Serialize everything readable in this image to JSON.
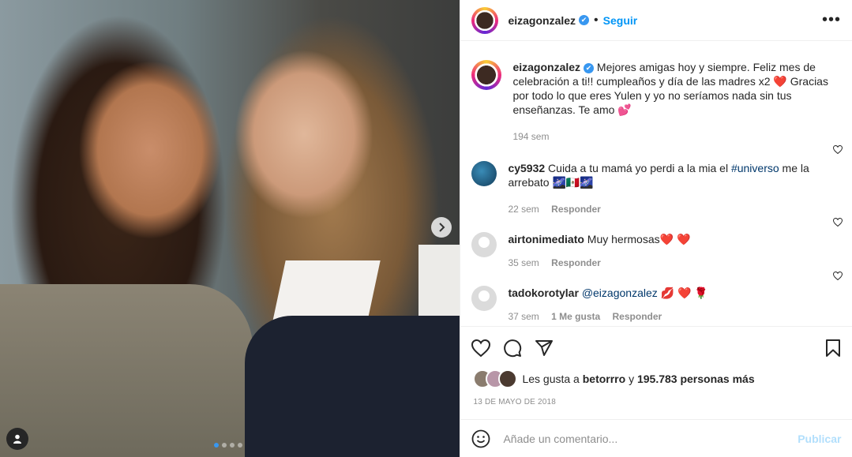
{
  "post": {
    "photo_alt": "Selfie de dos mujeres",
    "carousel_dots": 4,
    "active_dot": 0
  },
  "header": {
    "username": "eizagonzalez",
    "verified_mark": "✔",
    "separator": "•",
    "follow_label": "Seguir",
    "more_label": "•••"
  },
  "caption": {
    "username": "eizagonzalez",
    "text": " Mejores amigas hoy y siempre. Feliz mes de celebración a ti!! cumpleaños y día de las madres x2 ",
    "heart": "❤️",
    "text2": "  Gracias por todo lo que eres Yulen y yo no seríamos nada sin tus enseñanzas. Te amo ",
    "heart2": "💕",
    "time": "194 sem"
  },
  "comments": [
    {
      "username": "cy5932",
      "text_before": " Cuida a tu mamá yo perdi a la mia el ",
      "tag": "#universo",
      "text_after": " me la arrebato ",
      "emoji": "🌌🇲🇽🌌",
      "time": "22 sem",
      "reply": "Responder"
    },
    {
      "username": "airtonimediato",
      "text_before": " Muy hermosas",
      "emoji": "❤️ ❤️",
      "time": "35 sem",
      "reply": "Responder"
    },
    {
      "username": "tadokorotylar",
      "tag": "@eizagonzalez",
      "emoji": " 💋 ❤️ 🌹",
      "time": "37 sem",
      "likes": "1 Me gusta",
      "reply": "Responder"
    }
  ],
  "likes": {
    "prefix": "Les gusta a ",
    "user": "betorrro",
    "middle": " y ",
    "count": "195.783 personas más"
  },
  "date": "13 DE MAYO DE 2018",
  "add_comment": {
    "placeholder": "Añade un comentario...",
    "publish": "Publicar"
  },
  "icons": {
    "like": "heart-outline-icon",
    "comment": "comment-bubble-icon",
    "share": "paper-plane-icon",
    "save": "bookmark-icon",
    "emoji": "smiley-icon",
    "next": "chevron-right-icon",
    "user_tag": "person-icon"
  }
}
